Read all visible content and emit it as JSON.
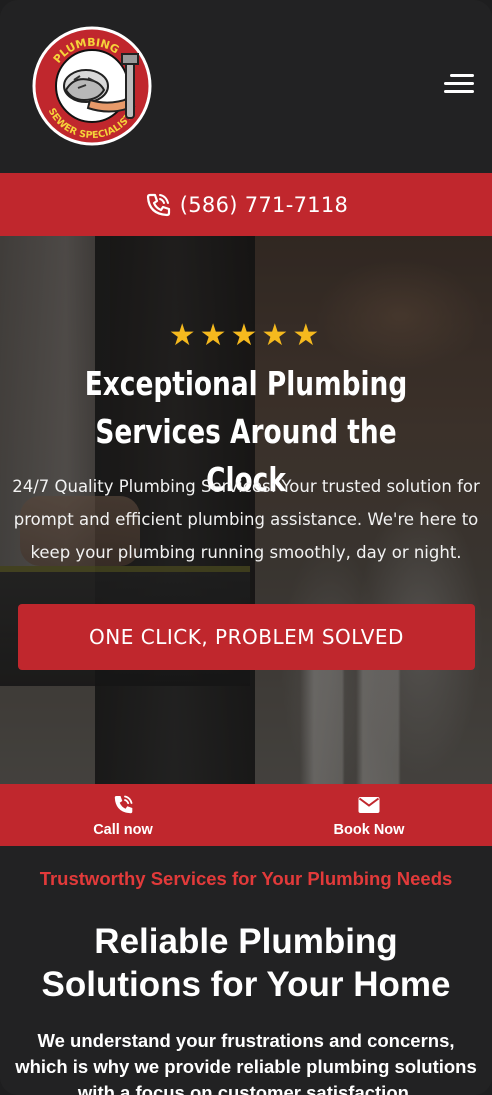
{
  "logo": {
    "text_top": "PLUMBING &",
    "text_bottom": "SEWER SPECIALISTS",
    "colors": {
      "ring": "#c0272d",
      "ring_text": "#f5d33a"
    }
  },
  "header": {
    "menu_icon": "hamburger-menu-icon"
  },
  "phone_bar": {
    "icon": "phone-ringing-icon",
    "number": "(586) 771-7118"
  },
  "hero": {
    "rating_stars": 5,
    "stars_text": "★★★★★",
    "title": "Exceptional Plumbing Services Around the Clock",
    "description": "24/7 Quality Plumbing Services: Your trusted solution for prompt and efficient plumbing assistance. We're here to keep your plumbing running smoothly, day or night.",
    "cta_label": "ONE CLICK, PROBLEM SOLVED"
  },
  "action_bar": {
    "items": [
      {
        "icon": "phone-icon",
        "label": "Call now"
      },
      {
        "icon": "envelope-icon",
        "label": "Book Now"
      }
    ]
  },
  "section": {
    "kicker": "Trustworthy Services for Your Plumbing Needs",
    "title": "Reliable Plumbing Solutions for Your Home",
    "text": "We understand your frustrations and concerns, which is why we provide reliable plumbing solutions with a focus on customer satisfaction."
  },
  "colors": {
    "brand_red": "#c0272d",
    "star_gold": "#f5b91e",
    "kicker_red": "#e23a3a",
    "background": "#222223"
  }
}
